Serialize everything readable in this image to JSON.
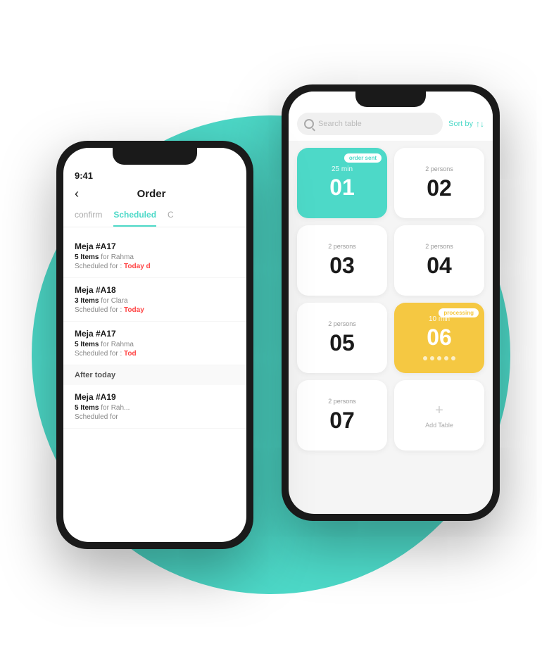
{
  "background": {
    "circle_color": "#4dd9c8"
  },
  "phone_back": {
    "search": {
      "placeholder": "Search table"
    },
    "sort_by": "Sort by",
    "sort_icon": "↑↓",
    "tables": [
      {
        "id": "01",
        "status": "order sent",
        "timer": "25 min",
        "style": "teal",
        "has_badge": true,
        "has_timer": true
      },
      {
        "id": "02",
        "persons": "2 persons",
        "style": "white",
        "has_badge": false,
        "has_timer": false
      },
      {
        "id": "03",
        "persons": "2 persons",
        "style": "white",
        "has_badge": false,
        "has_timer": false
      },
      {
        "id": "04",
        "persons": "2 persons",
        "style": "white",
        "has_badge": false,
        "has_timer": false
      },
      {
        "id": "05",
        "persons": "2 persons",
        "style": "white",
        "has_badge": false,
        "has_timer": false
      },
      {
        "id": "06",
        "status": "processing",
        "timer": "10 min",
        "style": "yellow",
        "has_badge": true,
        "has_timer": true,
        "has_dots": true
      },
      {
        "id": "07",
        "persons": "2 persons",
        "style": "white",
        "has_badge": false,
        "has_timer": false
      },
      {
        "id": "add",
        "label": "Add Table",
        "style": "add"
      }
    ]
  },
  "phone_front": {
    "status_bar": {
      "time": "9:41"
    },
    "header": {
      "back_arrow": "‹",
      "title": "Order"
    },
    "tabs": [
      {
        "label": "confirm",
        "active": false
      },
      {
        "label": "Scheduled",
        "active": true
      },
      {
        "label": "C",
        "active": false
      }
    ],
    "orders": [
      {
        "table": "Meja #A17",
        "items_count": "5",
        "customer": "Rahma",
        "schedule_prefix": "Scheduled for : ",
        "schedule": "Today ..."
      },
      {
        "table": "Meja #A18",
        "items_count": "3",
        "customer": "Clara",
        "schedule_prefix": "Scheduled for : ",
        "schedule": "Today"
      },
      {
        "table": "Meja #A17",
        "items_count": "5",
        "customer": "Rahma",
        "schedule_prefix": "Scheduled for : ",
        "schedule": "Tod..."
      }
    ],
    "section_divider": "After today",
    "orders_after": [
      {
        "table": "Meja #A19",
        "items_count": "5",
        "customer": "Rah...",
        "schedule_prefix": "Scheduled for",
        "schedule": ""
      }
    ]
  }
}
